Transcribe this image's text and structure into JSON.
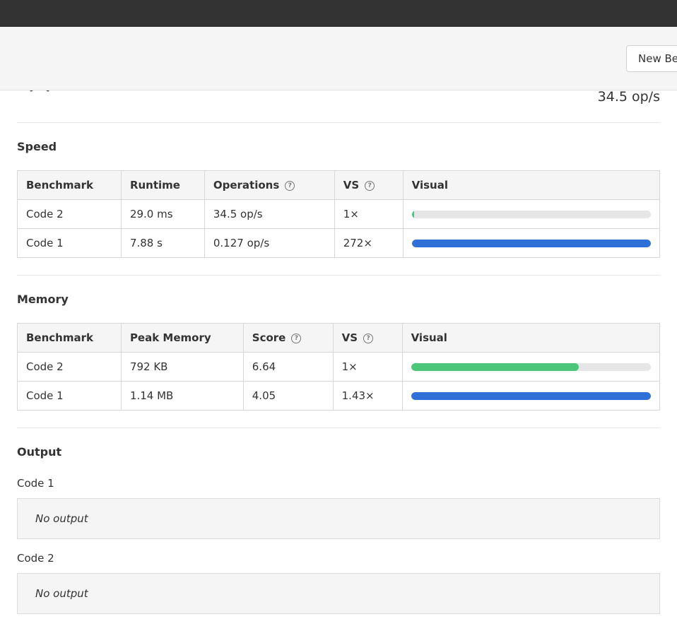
{
  "toolbar": {
    "new_button_label": "New Be"
  },
  "summary": {
    "top_ops": "34.5 op/s"
  },
  "speed": {
    "title": "Speed",
    "headers": {
      "benchmark": "Benchmark",
      "runtime": "Runtime",
      "operations": "Operations",
      "vs": "VS",
      "visual": "Visual"
    },
    "rows": [
      {
        "benchmark": "Code 2",
        "runtime": "29.0 ms",
        "operations": "34.5 op/s",
        "vs": "1×",
        "bar_fraction": 0.004,
        "bar_color": "#4cc779"
      },
      {
        "benchmark": "Code 1",
        "runtime": "7.88 s",
        "operations": "0.127 op/s",
        "vs": "272×",
        "bar_fraction": 1.0,
        "bar_color": "#2f6fd8"
      }
    ]
  },
  "memory": {
    "title": "Memory",
    "headers": {
      "benchmark": "Benchmark",
      "peak_memory": "Peak Memory",
      "score": "Score",
      "vs": "VS",
      "visual": "Visual"
    },
    "rows": [
      {
        "benchmark": "Code 2",
        "peak_memory": "792 KB",
        "score": "6.64",
        "vs": "1×",
        "bar_fraction": 0.7,
        "bar_color": "#4cc779"
      },
      {
        "benchmark": "Code 1",
        "peak_memory": "1.14 MB",
        "score": "4.05",
        "vs": "1.43×",
        "bar_fraction": 1.0,
        "bar_color": "#2f6fd8"
      }
    ]
  },
  "output": {
    "title": "Output",
    "items": [
      {
        "label": "Code 1",
        "text": "No output"
      },
      {
        "label": "Code 2",
        "text": "No output"
      }
    ]
  },
  "colors": {
    "green": "#4cc779",
    "blue": "#2f6fd8",
    "track": "#e6e6e6",
    "topbar": "#333333"
  }
}
